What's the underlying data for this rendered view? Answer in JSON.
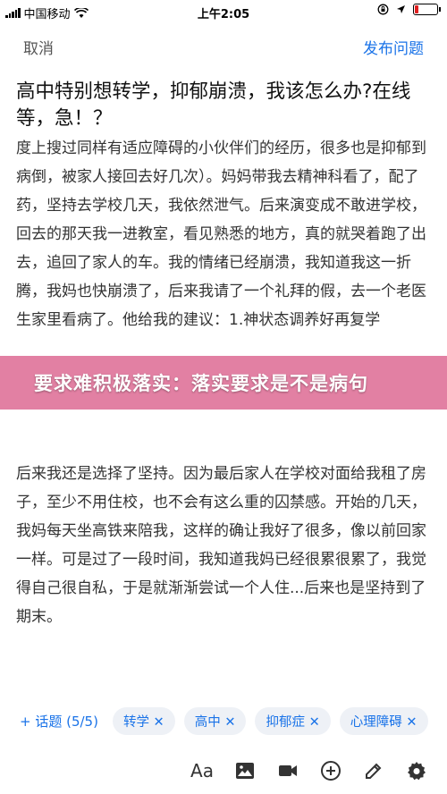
{
  "status": {
    "carrier": "中国移动",
    "time": "上午2:05"
  },
  "nav": {
    "cancel": "取消",
    "publish": "发布问题"
  },
  "question": {
    "title": "高中特别想转学，抑郁崩溃，我该怎么办?在线等，急！？",
    "body1": "度上搜过同样有适应障碍的小伙伴们的经历，很多也是抑郁到病倒，被家人接回去好几次）。妈妈带我去精神科看了，配了药，坚持去学校几天，我依然泄气。后来演变成不敢进学校，回去的那天我一进教室，看见熟悉的地方，真的就哭着跑了出去，追回了家人的车。我的情绪已经崩溃，我知道我这一折腾，我妈也快崩溃了，后来我请了一个礼拜的假，去一个老医生家里看病了。他给我的建议：1.神状态调养好再复学",
    "body2": "后来我还是选择了坚持。因为最后家人在学校对面给我租了房子，至少不用住校，也不会有这么重的囚禁感。开始的几天，我妈每天坐高铁来陪我，这样的确让我好了很多，像以前回家一样。可是过了一段时间，我知道我妈已经很累很累了，我觉得自己很自私，于是就渐渐尝试一个人住...后来也是坚持到了期末。"
  },
  "banner": {
    "text": "要求难积极落实：落实要求是不是病句"
  },
  "tags": {
    "add_topic": "+ 话题 (5/5)",
    "items": [
      "转学 ✕",
      "高中 ✕",
      "抑郁症 ✕",
      "心理障碍 ✕"
    ]
  },
  "toolbar": {
    "font_label": "Aa",
    "icons": [
      "font-size-icon",
      "image-icon",
      "video-icon",
      "insert-icon",
      "more-icon",
      "settings-icon"
    ]
  },
  "colors": {
    "accent": "#1a73e8",
    "banner": "#de6e96",
    "battery_low": "#e02020"
  }
}
